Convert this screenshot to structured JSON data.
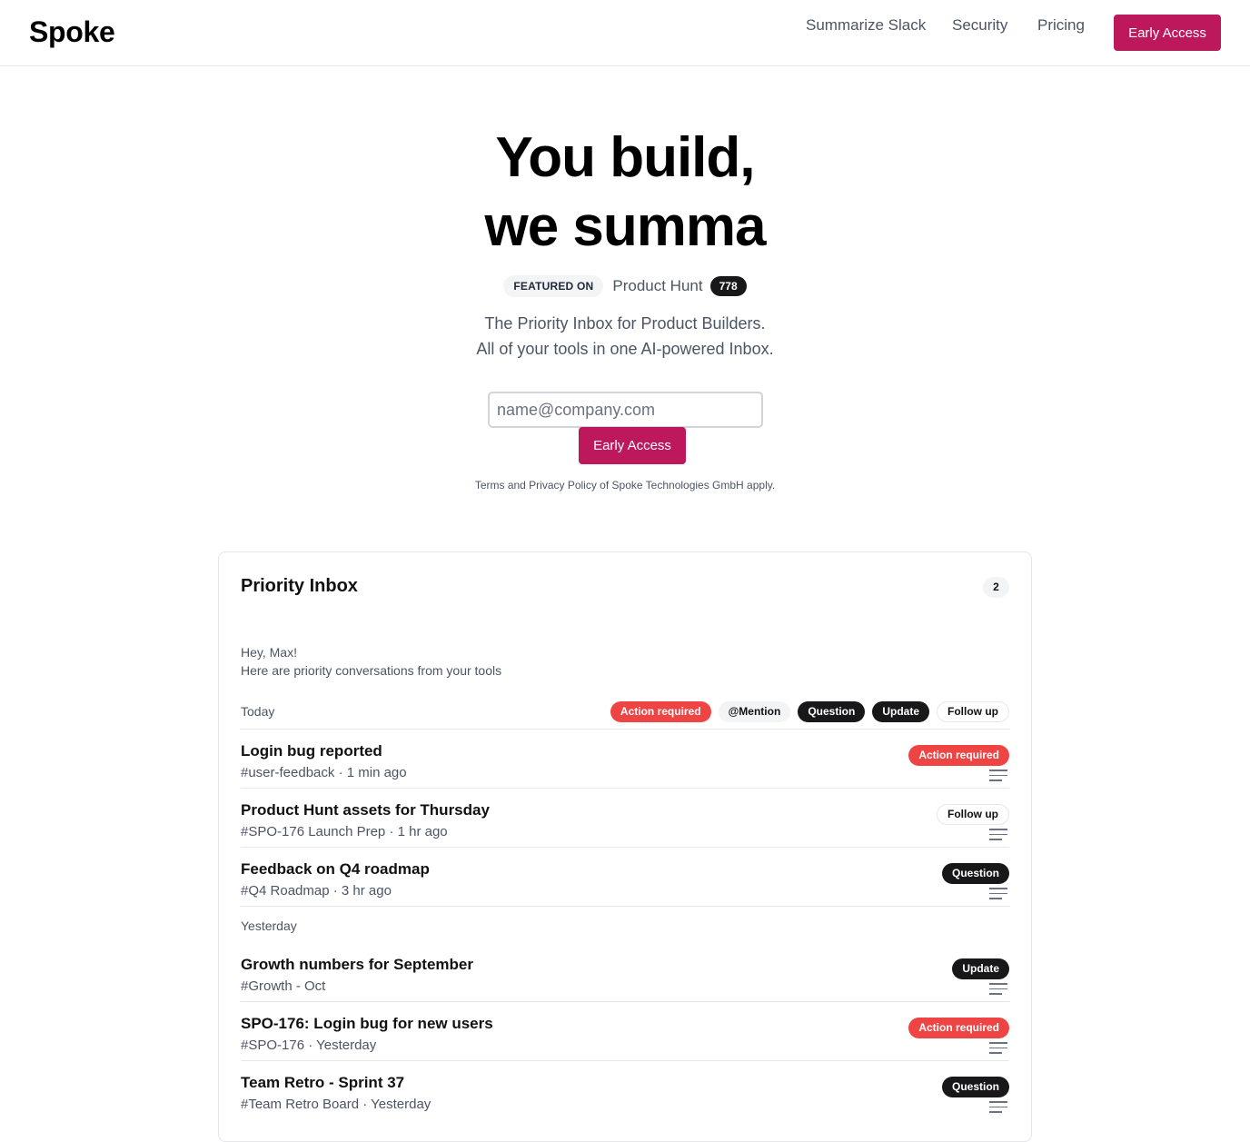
{
  "header": {
    "logo": "Spoke",
    "nav": {
      "summarize_slack": "Summarize Slack",
      "security": "Security",
      "pricing": "Pricing"
    },
    "cta": "Early Access"
  },
  "hero": {
    "title_line1": "You build,",
    "title_line2": "we summa",
    "featured_label": "FEATURED ON",
    "product_hunt": "Product Hunt",
    "product_hunt_count": "778",
    "subtitle_line1": "The Priority Inbox for Product Builders.",
    "subtitle_line2": "All of your tools in one AI-powered Inbox.",
    "email_placeholder": "name@company.com",
    "cta": "Early Access",
    "terms": "Terms and Privacy Policy of Spoke Technologies GmbH apply."
  },
  "inbox": {
    "title": "Priority Inbox",
    "count": "2",
    "greeting_line1": "Hey, Max!",
    "greeting_line2": "Here are priority conversations from your tools",
    "filters": [
      "Action required",
      "@Mention",
      "Question",
      "Update",
      "Follow up"
    ],
    "groups": [
      {
        "label": "Today",
        "items": [
          {
            "title": "Login bug reported",
            "meta": "#user-feedback · 1 min ago",
            "tag": "Action required"
          },
          {
            "title": "Product Hunt assets for Thursday",
            "meta": "#SPO-176 Launch Prep · 1 hr ago",
            "tag": "Follow up"
          },
          {
            "title": "Feedback on Q4 roadmap",
            "meta": "#Q4 Roadmap · 3 hr ago",
            "tag": "Question"
          }
        ]
      },
      {
        "label": "Yesterday",
        "items": [
          {
            "title": "Growth numbers for September",
            "meta": "#Growth - Oct",
            "tag": "Update"
          },
          {
            "title": "SPO-176: Login bug for new users",
            "meta": "#SPO-176 · Yesterday",
            "tag": "Action required"
          },
          {
            "title": "Team Retro - Sprint 37",
            "meta": "#Team Retro Board · Yesterday",
            "tag": "Question"
          }
        ]
      }
    ]
  },
  "colors": {
    "brand": "#be185d",
    "action_required": "#ef4444",
    "dark_tag": "#18181b"
  },
  "icons": {
    "item_menu": "menu-lines-icon"
  }
}
